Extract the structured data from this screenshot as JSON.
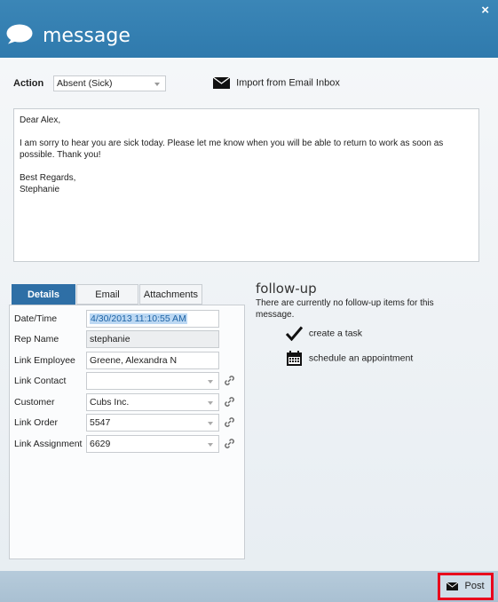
{
  "window": {
    "title": "message",
    "close_label": "×",
    "icons": {
      "title": "speech-bubble-icon",
      "close": "close-icon"
    },
    "colors": {
      "header": "#2f7aad",
      "tab_active": "#2e6fa6",
      "post_highlight": "#e8001c"
    }
  },
  "action": {
    "label": "Action",
    "selected": "Absent (Sick)",
    "import_label": "Import from Email Inbox",
    "import_icon": "envelope-icon"
  },
  "message": {
    "greeting": "Dear Alex,",
    "body": "I am sorry to hear you are sick today. Please let me know when you will be able to return to work as soon as possible. Thank you!",
    "closing": "Best Regards,",
    "signature": "Stephanie"
  },
  "tabs": [
    {
      "label": "Details",
      "active": true
    },
    {
      "label": "Email",
      "active": false
    },
    {
      "label": "Attachments",
      "active": false
    }
  ],
  "details": {
    "date_time": {
      "label": "Date/Time",
      "value": "4/30/2013 11:10:55 AM"
    },
    "rep_name": {
      "label": "Rep Name",
      "value": "stephanie"
    },
    "link_employee": {
      "label": "Link Employee",
      "value": "Greene, Alexandra N"
    },
    "link_contact": {
      "label": "Link Contact",
      "value": ""
    },
    "customer": {
      "label": "Customer",
      "value": "Cubs Inc."
    },
    "link_order": {
      "label": "Link Order",
      "value": "5547"
    },
    "link_assignment": {
      "label": "Link Assignment",
      "value": "6629"
    },
    "link_icon": "chain-link-icon"
  },
  "followup": {
    "title": "follow-up",
    "text": "There are currently no follow-up items for this message.",
    "create_task": "create a task",
    "schedule": "schedule an appointment",
    "icons": {
      "task": "checkmark-icon",
      "schedule": "calendar-icon"
    }
  },
  "footer": {
    "post_label": "Post",
    "post_icon": "envelope-icon"
  }
}
